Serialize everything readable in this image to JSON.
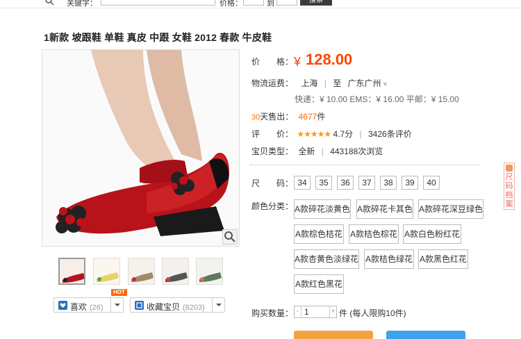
{
  "topbar": {
    "keyword_label": "关键字：",
    "price_label": "价格：",
    "to_label": "到",
    "search_button": "搜索"
  },
  "product": {
    "title": "1新款 坡跟鞋 单鞋 真皮 中跟 女鞋 2012 春款 牛皮鞋"
  },
  "price": {
    "label": "价　　格：",
    "symbol": "¥",
    "value": "128.00"
  },
  "shipping": {
    "label": "物流运费：",
    "from": "上海",
    "to_word": "至",
    "to": "广东广州",
    "rates": "快递：¥ 10.00 EMS：¥ 16.00 平邮：¥ 15.00"
  },
  "sales": {
    "days": "30",
    "label": "天售出：",
    "count": "4677",
    "unit": "件"
  },
  "rating": {
    "label": "评　　价：",
    "stars": "★★★★★",
    "score": "4.7分",
    "reviews": "3426条评价"
  },
  "item_type": {
    "label": "宝贝类型：",
    "condition": "全新",
    "views": "443188次浏览"
  },
  "size": {
    "label": "尺　　码：",
    "options": [
      "34",
      "35",
      "36",
      "37",
      "38",
      "39",
      "40"
    ]
  },
  "color": {
    "label": "颜色分类：",
    "options": [
      "A款碎花淡黄色",
      "A款碎花卡其色",
      "A款碎花深豆绿色",
      "A款棕色桔花",
      "A款桔色棕花",
      "A款白色粉红花",
      "A款杏黄色淡绿花",
      "A款桔色绿花",
      "A款黑色红花",
      "A款红色黑花"
    ]
  },
  "quantity": {
    "label": "购买数量：",
    "minus": "-",
    "value": "1",
    "plus": "+",
    "note": "件 (每人限购10件)"
  },
  "social": {
    "like_label": "喜欢",
    "like_count": "(26)",
    "hot_badge": "HOT",
    "fav_label": "收藏宝贝",
    "fav_count": "(8203)"
  },
  "side_tab": {
    "label": "尺码档案"
  },
  "colors": {
    "price": "#ff4400",
    "accent": "#ff6600",
    "buy": "#f3a242",
    "cart": "#3ca3ea"
  }
}
